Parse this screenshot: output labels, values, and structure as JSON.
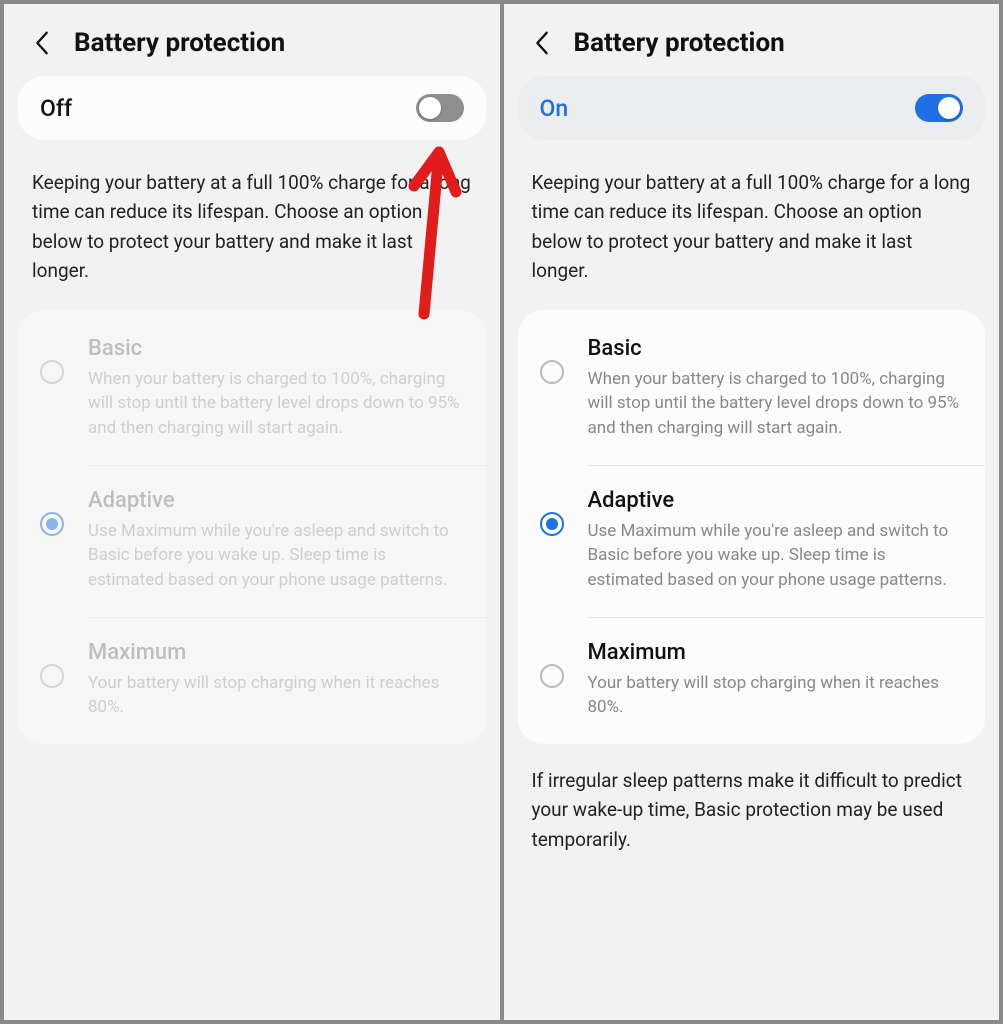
{
  "left": {
    "title": "Battery protection",
    "toggle_state_label": "Off",
    "toggle_on": false,
    "description": "Keeping your battery at a full 100% charge for a long time can reduce its lifespan. Choose an option below to protect your battery and make it last longer.",
    "options_disabled": true,
    "selected_option": "adaptive",
    "options": {
      "basic": {
        "title": "Basic",
        "desc": "When your battery is charged to 100%, charging will stop until the battery level drops down to 95% and then charging will start again."
      },
      "adaptive": {
        "title": "Adaptive",
        "desc": "Use Maximum while you're asleep and switch to Basic before you wake up. Sleep time is estimated based on your phone usage patterns."
      },
      "maximum": {
        "title": "Maximum",
        "desc": "Your battery will stop charging when it reaches 80%."
      }
    }
  },
  "right": {
    "title": "Battery protection",
    "toggle_state_label": "On",
    "toggle_on": true,
    "description": "Keeping your battery at a full 100% charge for a long time can reduce its lifespan. Choose an option below to protect your battery and make it last longer.",
    "options_disabled": false,
    "selected_option": "adaptive",
    "options": {
      "basic": {
        "title": "Basic",
        "desc": "When your battery is charged to 100%, charging will stop until the battery level drops down to 95% and then charging will start again."
      },
      "adaptive": {
        "title": "Adaptive",
        "desc": "Use Maximum while you're asleep and switch to Basic before you wake up. Sleep time is estimated based on your phone usage patterns."
      },
      "maximum": {
        "title": "Maximum",
        "desc": "Your battery will stop charging when it reaches 80%."
      }
    },
    "footnote": "If irregular sleep patterns make it difficult to predict your wake-up time, Basic protection may be used temporarily."
  },
  "annotation": {
    "arrow_color": "#e21b1b",
    "arrow_target": "left-screen-toggle"
  }
}
